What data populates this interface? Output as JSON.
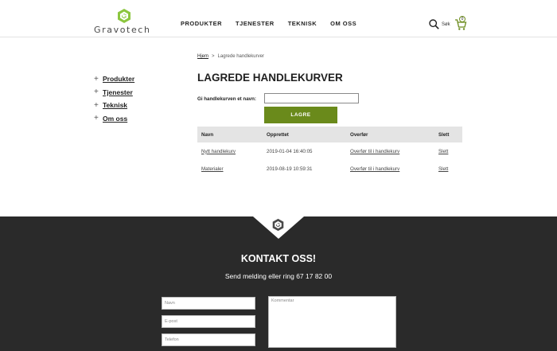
{
  "brand": {
    "name": "Gravotech",
    "logo_text": "Gravotech",
    "accent_color": "#6a8a1b",
    "logo_green": "#8cc63f"
  },
  "nav": {
    "items": [
      "PRODUKTER",
      "TJENESTER",
      "TEKNISK",
      "OM OSS"
    ]
  },
  "header": {
    "search_label": "Søk",
    "cart_count": "0",
    "search_icon": "search-icon",
    "cart_icon": "cart-icon"
  },
  "sidebar": {
    "items": [
      {
        "label": "Produkter"
      },
      {
        "label": "Tjenester"
      },
      {
        "label": "Teknisk"
      },
      {
        "label": "Om oss"
      }
    ]
  },
  "breadcrumb": {
    "home": "Hjem",
    "separator": ">",
    "current": "Lagrede handlekurver"
  },
  "page": {
    "title": "LAGREDE HANDLEKURVER"
  },
  "form": {
    "label": "Gi handlekurven et navn:",
    "input_value": "",
    "save_label": "LAGRE"
  },
  "table": {
    "headers": [
      "Navn",
      "Opprettet",
      "Overfør",
      "Slett"
    ],
    "rows": [
      {
        "name": "Nytt handlekurv",
        "created": "2019-01-04 16:40:05",
        "transfer": "Overfør til i handlekurv",
        "delete": "Slett"
      },
      {
        "name": "Materialer",
        "created": "2019-08-19 10:59:31",
        "transfer": "Overfør til i handlekurv",
        "delete": "Slett"
      }
    ]
  },
  "footer": {
    "title": "KONTAKT OSS!",
    "subtitle": "Send melding eller ring 67 17 82 00",
    "fields": {
      "name_placeholder": "Navn",
      "email_placeholder": "E-post",
      "phone_placeholder": "Telefon",
      "comment_placeholder": "Kommentar"
    }
  }
}
